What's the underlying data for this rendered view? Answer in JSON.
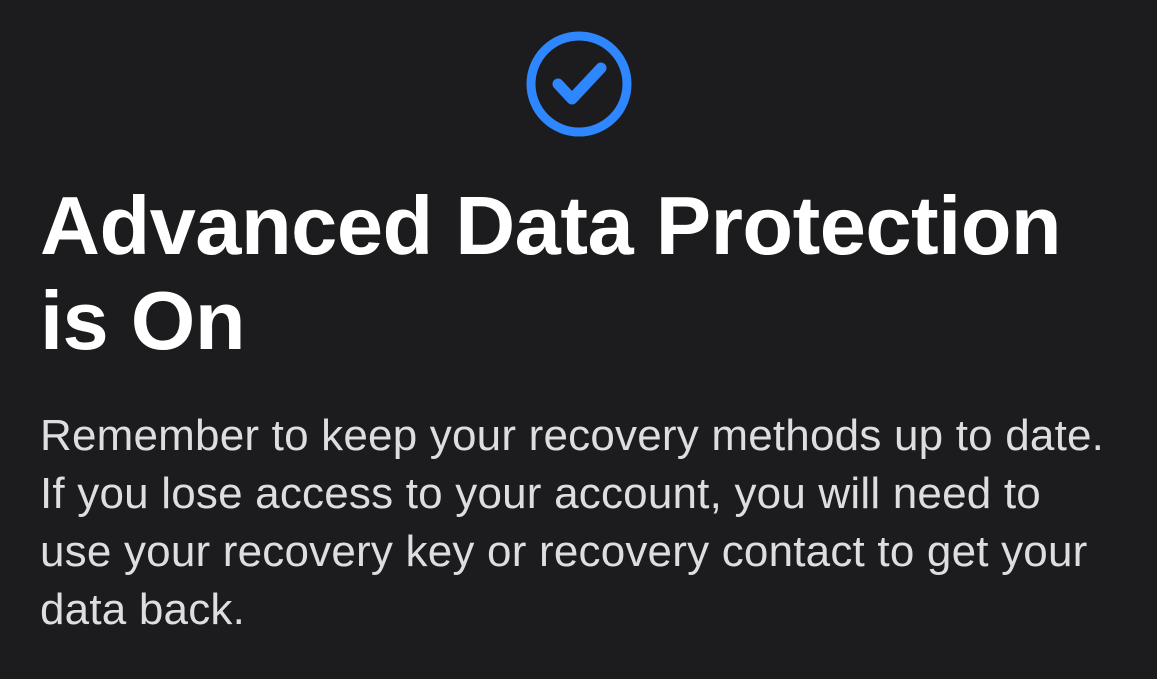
{
  "icon": {
    "name": "checkmark-circle-icon",
    "color": "#2f87ff"
  },
  "heading": "Advanced Data Protection is On",
  "description": "Remember to keep your recovery methods up to date. If you lose access to your account, you will need to use your recovery key or recovery contact to get your data back."
}
